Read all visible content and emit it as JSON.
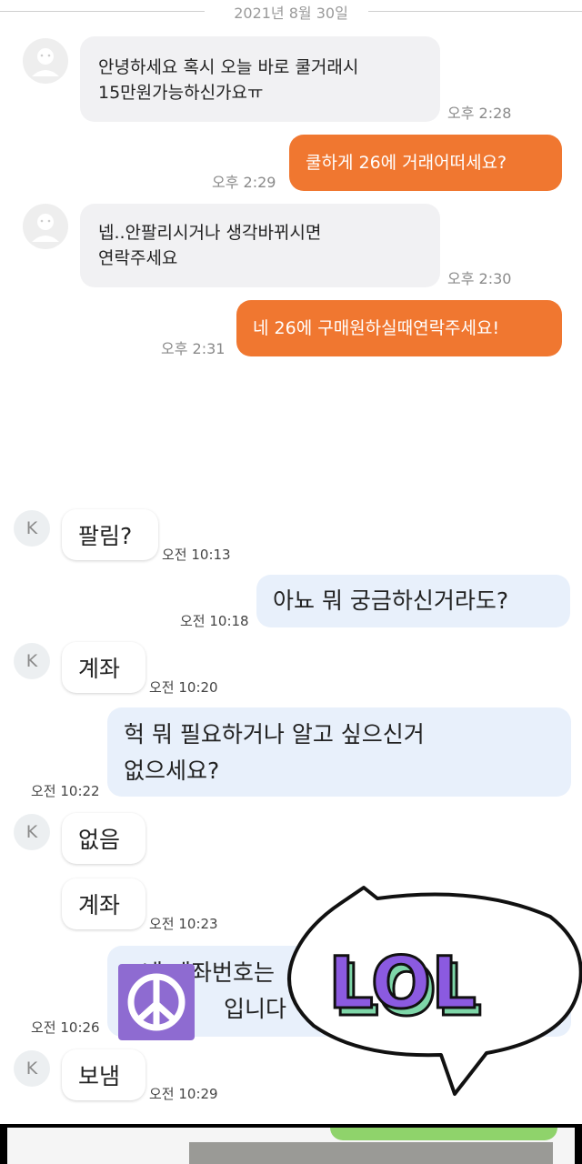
{
  "date_divider": "2021년 8월 30일",
  "chat1": [
    {
      "side": "left",
      "lines": [
        "안녕하세요 혹시 오늘 바로 쿨거래시",
        "15만원가능하신가요ㅠ"
      ],
      "time": "오후 2:28"
    },
    {
      "side": "right",
      "lines": [
        "쿨하게 26에 거래어떠세요?"
      ],
      "time": "오후 2:29"
    },
    {
      "side": "left",
      "lines": [
        "넵..안팔리시거나 생각바뀌시면",
        "연락주세요"
      ],
      "time": "오후 2:30"
    },
    {
      "side": "right",
      "lines": [
        "네 26에 구매원하실때연락주세요!"
      ],
      "time": "오후 2:31"
    }
  ],
  "chat2": {
    "avatar_letter": "K",
    "messages": [
      {
        "side": "left",
        "text": "팔림?",
        "time": "오전 10:13"
      },
      {
        "side": "right",
        "text": "아뇨 뭐 궁금하신거라도?",
        "time": "오전 10:18"
      },
      {
        "side": "left",
        "text": "계좌",
        "time": "오전 10:20"
      },
      {
        "side": "right",
        "lines": [
          "헉 뭐 필요하거나 알고 싶으신거",
          "없으세요?"
        ],
        "time": "오전 10:22"
      },
      {
        "side": "left",
        "text": "없음",
        "time": ""
      },
      {
        "side": "left",
        "text": "계좌",
        "time": "오전 10:23"
      },
      {
        "side": "right",
        "lines": [
          "네 계좌번호는",
          "입니다"
        ],
        "time": "오전 10:26"
      },
      {
        "side": "left",
        "text": "보냄",
        "time": "오전 10:29"
      }
    ]
  },
  "stickers": {
    "lol_text": "LOL",
    "peace_icon": "peace-icon"
  },
  "colors": {
    "orange": "#f07730",
    "grey_bubble": "#f1f1f3",
    "blue_bubble": "#e8f0fb",
    "lol_purple": "#8b5ae0",
    "lol_green": "#7ed6a8",
    "peace_bg": "#8e6bd1"
  }
}
